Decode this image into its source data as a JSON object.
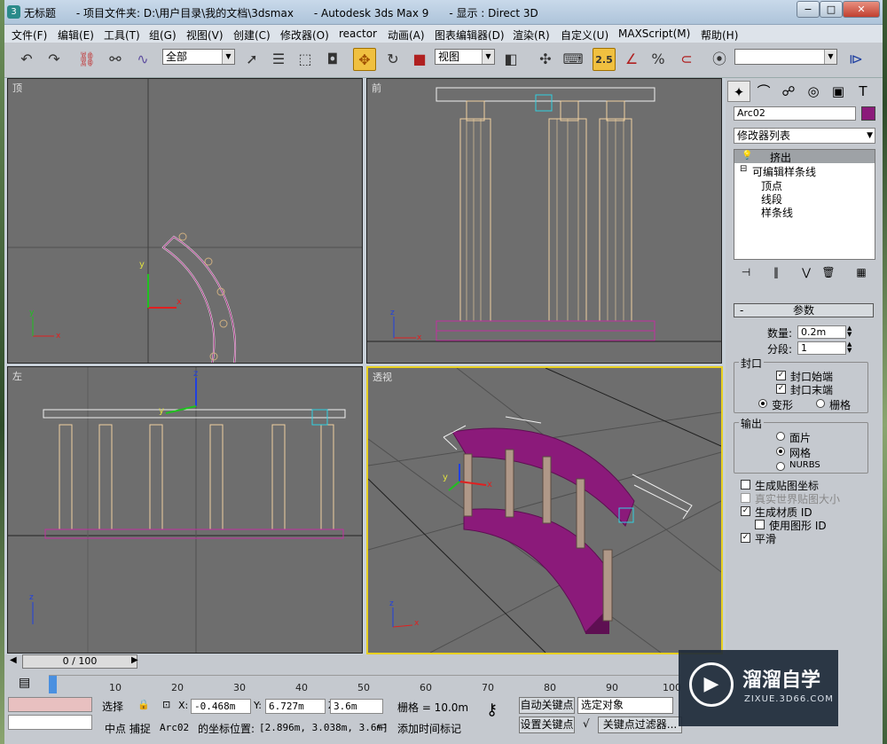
{
  "window": {
    "title": "无标题      - 项目文件夹: D:\\用户目录\\我的文档\\3dsmax      - Autodesk 3ds Max 9      - 显示 : Direct 3D",
    "app_icon": "3ds-max-icon",
    "buttons": [
      "−",
      "□",
      "✕"
    ]
  },
  "menu": [
    "文件(F)",
    "编辑(E)",
    "工具(T)",
    "组(G)",
    "视图(V)",
    "创建(C)",
    "修改器(O)",
    "reactor",
    "动画(A)",
    "图表编辑器(D)",
    "渲染(R)",
    "自定义(U)",
    "MAXScript(M)",
    "帮助(H)"
  ],
  "toolbar": {
    "selection_filter": "全部",
    "ref_coord": "视图",
    "snap_value": "2.5",
    "named_selection": ""
  },
  "viewports": {
    "top": "顶",
    "front": "前",
    "left": "左",
    "persp": "透视"
  },
  "axis": {
    "x": "x",
    "y": "y",
    "z": "z"
  },
  "panel": {
    "object_name": "Arc02",
    "object_color": "#8b1a7a",
    "modifier_list": "修改器列表",
    "stack": {
      "extrude": "挤出",
      "editable_spline": "可编辑样条线",
      "vertex": "顶点",
      "segment": "线段",
      "spline": "样条线"
    },
    "rollout": "参数",
    "rollout_toggle": "-",
    "amount_label": "数量:",
    "amount_value": "0.2m",
    "segments_label": "分段:",
    "segments_value": "1",
    "capping_title": "封口",
    "cap_start": "封口始端",
    "cap_end": "封口末端",
    "morph": "变形",
    "grid": "栅格",
    "output_title": "输出",
    "patch": "面片",
    "mesh": "网格",
    "nurbs": "NURBS",
    "gen_map": "生成贴图坐标",
    "real_world": "真实世界贴图大小",
    "gen_mat": "生成材质 ID",
    "use_shape": "使用图形 ID",
    "smooth": "平滑"
  },
  "timeline": {
    "frame": "0 / 100",
    "ticks": [
      "0",
      "10",
      "20",
      "30",
      "40",
      "50",
      "60",
      "70",
      "80",
      "90",
      "100"
    ]
  },
  "status": {
    "select": "选择",
    "x_label": "X:",
    "x_value": "-0.468m",
    "y_label": "Y:",
    "y_value": "6.727m",
    "z_label": "Z:",
    "z_value": "3.6m",
    "grid": "栅格 = 10.0m",
    "autokey": "自动关键点",
    "sel_obj": "选定对象",
    "setkey": "设置关键点",
    "keyfilter": "关键点过滤器...",
    "prompt_snap": "中点 捕捉",
    "prompt_obj": "Arc02",
    "prompt_coord": "的坐标位置:",
    "prompt_val": "[2.896m, 3.038m, 3.6m]",
    "add_time_tag": "添加时间标记"
  },
  "watermark": {
    "brand": "溜溜自学",
    "url": "ZIXUE.3D66.COM"
  }
}
